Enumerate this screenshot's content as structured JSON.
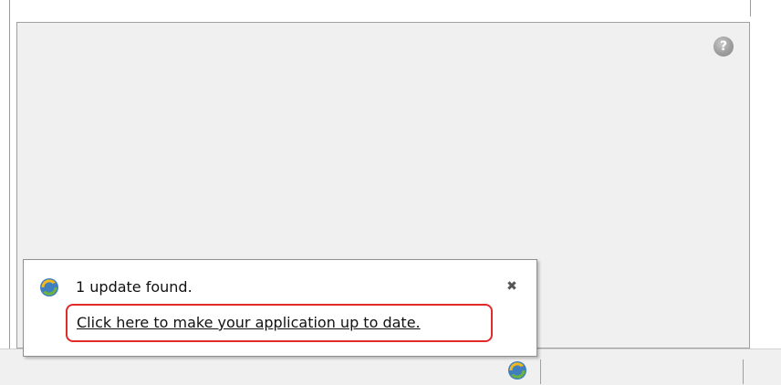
{
  "colors": {
    "panel_bg": "#f0f0f0",
    "highlight": "#e12a2a",
    "help_icon": "#9d9d9d"
  },
  "help": {
    "icon": "help-icon",
    "glyph": "?"
  },
  "notification": {
    "icon": "update-refresh-icon",
    "title": "1 update found.",
    "close_glyph": "✖",
    "link_text": "Click here to make your application up to date."
  },
  "status_bar": {
    "tray_icon": "update-refresh-icon"
  }
}
